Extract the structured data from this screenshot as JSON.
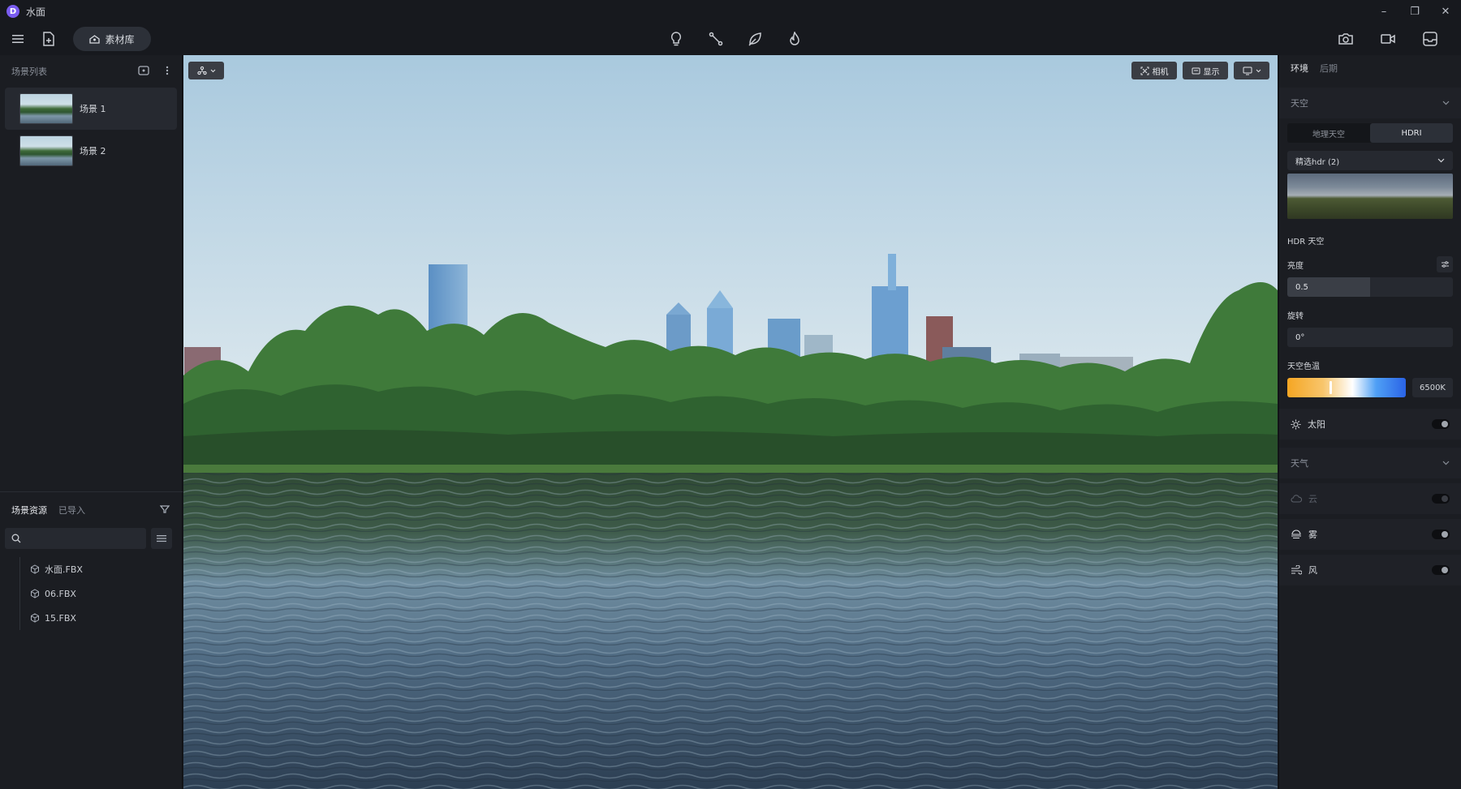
{
  "window": {
    "logo_text": "D",
    "title": "水面",
    "controls": {
      "minimize": "–",
      "restore": "❐",
      "close": "✕"
    }
  },
  "toolbar": {
    "library_label": "素材库",
    "left_icons": [
      "menu-icon",
      "new-file-icon"
    ],
    "center_icons": [
      "light-bulb-icon",
      "path-tool-icon",
      "leaf-icon",
      "fire-icon"
    ],
    "right_icons": [
      "camera-icon",
      "video-icon",
      "inbox-icon"
    ]
  },
  "left_panel": {
    "title": "场景列表",
    "scenes": [
      {
        "label": "场景 1",
        "active": true
      },
      {
        "label": "场景 2",
        "active": false
      }
    ],
    "resources": {
      "tabs": [
        "场景资源",
        "已导入"
      ],
      "search_placeholder": "",
      "files": [
        "水面.FBX",
        "06.FBX",
        "15.FBX"
      ]
    }
  },
  "viewport": {
    "buttons": {
      "camera_label": "相机",
      "display_label": "显示"
    }
  },
  "right_panel": {
    "tabs": [
      "环境",
      "后期"
    ],
    "sky": {
      "title": "天空",
      "modes": [
        "地理天空",
        "HDRI"
      ],
      "active_mode": "HDRI",
      "hdr_select": "精选hdr (2)",
      "hdr_section": "HDR 天空",
      "brightness_label": "亮度",
      "brightness_value": "0.5",
      "brightness_fraction": 0.5,
      "rotation_label": "旋转",
      "rotation_value": "0°",
      "temp_label": "天空色温",
      "temp_value": "6500K",
      "temp_fraction": 0.36,
      "sun_label": "太阳"
    },
    "weather": {
      "title": "天气",
      "items": [
        {
          "label": "云",
          "icon": "cloud-icon",
          "dim": true
        },
        {
          "label": "雾",
          "icon": "fog-icon",
          "dim": false
        },
        {
          "label": "风",
          "icon": "wind-icon",
          "dim": false
        }
      ]
    }
  },
  "colors": {
    "accent": "#7a5cf0",
    "panel_bg": "#1b1d22",
    "toolbar_bg": "#17191e"
  }
}
